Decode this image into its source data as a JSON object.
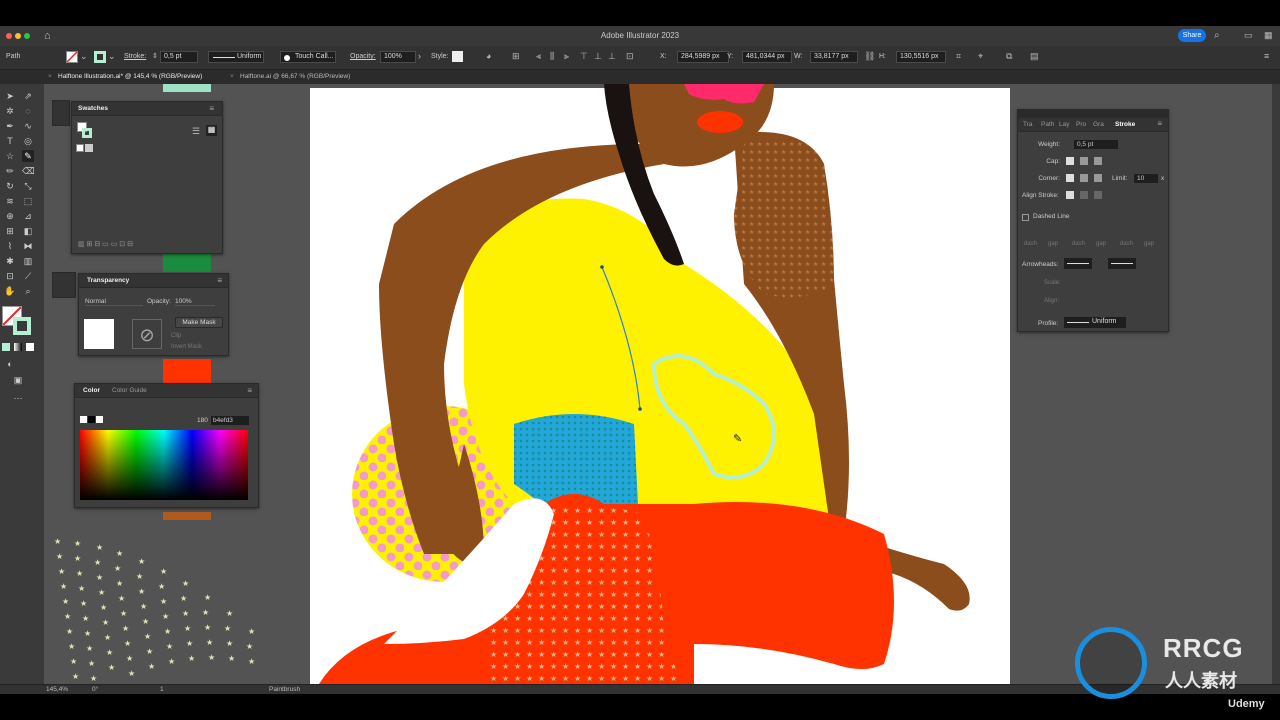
{
  "app": {
    "title": "Adobe Illustrator 2023",
    "share_label": "Share"
  },
  "controlbar": {
    "selection_type": "Path",
    "stroke_label": "Stroke:",
    "stroke_weight": "0,5 pt",
    "profile": "Uniform",
    "brush": "Touch Call...",
    "opacity_label": "Opacity:",
    "opacity": "100%",
    "style_label": "Style:",
    "x_label": "X:",
    "x": "284,5989 px",
    "y_label": "Y:",
    "y": "481,0344 px",
    "w_label": "W:",
    "w": "33,8177 px",
    "h_label": "H:",
    "h": "130,5516 px"
  },
  "tabs": [
    {
      "label": "Halftone Illustration.ai* @ 145,4 % (RGB/Preview)",
      "active": true
    },
    {
      "label": "Halftone.ai @ 66,67 % (RGB/Preview)",
      "active": false
    }
  ],
  "swatches_panel": {
    "title": "Swatches"
  },
  "transparency_panel": {
    "title": "Transparency",
    "blend_mode": "Normal",
    "opacity_label": "Opacity:",
    "opacity": "100%",
    "make_mask": "Make Mask",
    "clip": "Clip",
    "invert_mask": "Invert Mask"
  },
  "color_panel": {
    "tab_color": "Color",
    "tab_guide": "Color Guide",
    "hue": "180",
    "hex": "b4efd3"
  },
  "stroke_panel": {
    "tabs": [
      "Tra",
      "Path",
      "Lay",
      "Pro",
      "Gra",
      "Stroke"
    ],
    "weight_label": "Weight:",
    "weight": "0,5 pt",
    "cap_label": "Cap:",
    "corner_label": "Corner:",
    "limit_label": "Limit:",
    "limit": "10",
    "limit_unit": "x",
    "align_label": "Align Stroke:",
    "dashed_label": "Dashed Line",
    "dash_labels": [
      "dash",
      "gap",
      "dash",
      "gap",
      "dash",
      "gap"
    ],
    "arrowheads_label": "Arrowheads:",
    "scale_label": "Scale:",
    "align_label2": "Align:",
    "profile_label": "Profile:",
    "profile": "Uniform"
  },
  "status": {
    "zoom": "145,4%",
    "rotation": "0°",
    "artboard": "1",
    "tool": "Paintbrush"
  },
  "colors": {
    "skin": "#8b4d1c",
    "yellow": "#fff200",
    "red": "#ff3300",
    "blue": "#22a8d8",
    "pink": "#f59ac8",
    "mint": "#b4efd3",
    "stroke_selected": "#2a7fd4"
  },
  "watermark": {
    "brand": "RRCG",
    "sub": "人人素材",
    "platform": "Udemy"
  }
}
